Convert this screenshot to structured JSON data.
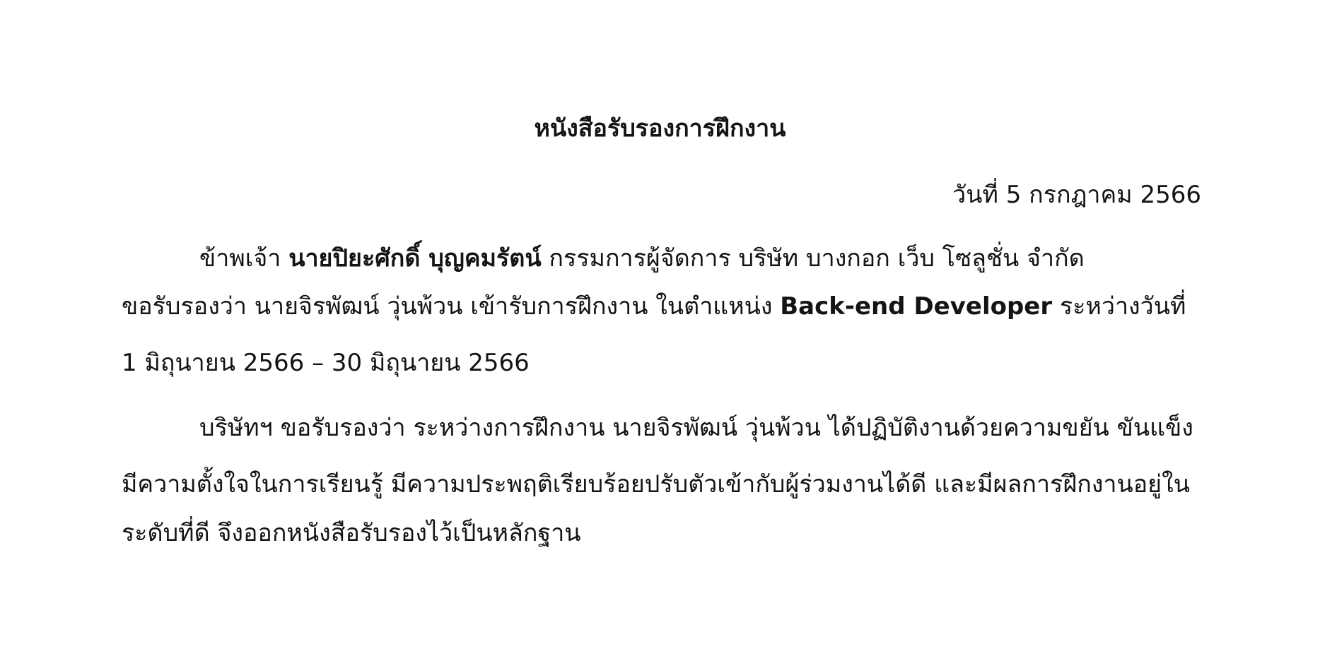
{
  "document": {
    "title": "หนังสือรับรองการฝึกงาน",
    "date": "วันที่ 5 กรกฎาคม 2566",
    "paragraph1": {
      "line1_prefix": "ข้าพเจ้า ",
      "line1_name_bold": "นายปิยะศักดิ์ บุญคมรัตน์",
      "line1_suffix": " กรรมการผู้จัดการ บริษัท บางกอก เว็บ โซลูชั่น จำกัด",
      "line2_prefix": "ขอรับรองว่า นายจิรพัฒน์ วุ่นพ้วน เข้ารับการฝึกงาน ในตำแหน่ง ",
      "line2_position_bold": "Back-end Developer",
      "line2_suffix": " ระหว่างวันที่",
      "line3": "1 มิถุนายน 2566 – 30 มิถุนายน 2566"
    },
    "paragraph2": {
      "line1": "บริษัทฯ ขอรับรองว่า ระหว่างการฝึกงาน นายจิรพัฒน์ วุ่นพ้วน ได้ปฏิบัติงานด้วยความขยัน ขันแข็ง",
      "line2": "มีความตั้งใจในการเรียนรู้ มีความประพฤติเรียบร้อยปรับตัวเข้ากับผู้ร่วมงานได้ดี และมีผลการฝึกงานอยู่ใน",
      "line3": "ระดับที่ดี จึงออกหนังสือรับรองไว้เป็นหลักฐาน"
    }
  }
}
